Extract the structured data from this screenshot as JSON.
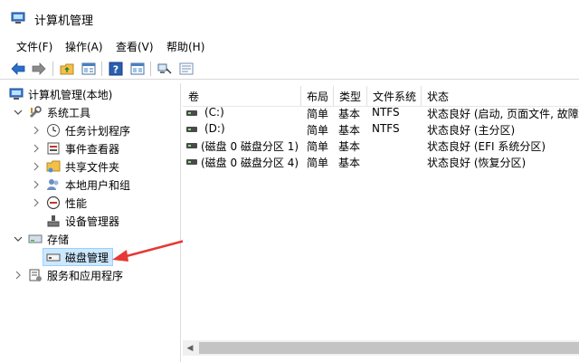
{
  "window": {
    "title": "计算机管理"
  },
  "menu": [
    {
      "label": "文件(F)"
    },
    {
      "label": "操作(A)"
    },
    {
      "label": "查看(V)"
    },
    {
      "label": "帮助(H)"
    }
  ],
  "toolbar": {
    "icons": [
      "back-arrow-icon",
      "forward-arrow-icon",
      "folder-up-icon",
      "show-hide-tree-icon",
      "help-icon",
      "properties-icon",
      "connect-icon",
      "list-view-icon"
    ]
  },
  "tree": {
    "root": "计算机管理(本地)",
    "system_tools": "系统工具",
    "task_scheduler": "任务计划程序",
    "event_viewer": "事件查看器",
    "shared_folders": "共享文件夹",
    "local_users": "本地用户和组",
    "performance": "性能",
    "device_manager": "设备管理器",
    "storage": "存储",
    "disk_management": "磁盘管理",
    "services": "服务和应用程序"
  },
  "columns": [
    {
      "label": "卷"
    },
    {
      "label": "布局"
    },
    {
      "label": "类型"
    },
    {
      "label": "文件系统"
    },
    {
      "label": "状态"
    }
  ],
  "volumes": [
    {
      "name": "(C:)",
      "layout": "简单",
      "type": "基本",
      "fs": "NTFS",
      "status": "状态良好 (启动, 页面文件, 故障转"
    },
    {
      "name": "(D:)",
      "layout": "简单",
      "type": "基本",
      "fs": "NTFS",
      "status": "状态良好 (主分区)"
    },
    {
      "name": "(磁盘 0 磁盘分区 1)",
      "layout": "简单",
      "type": "基本",
      "fs": "",
      "status": "状态良好 (EFI 系统分区)"
    },
    {
      "name": "(磁盘 0 磁盘分区 4)",
      "layout": "简单",
      "type": "基本",
      "fs": "",
      "status": "状态良好 (恢复分区)"
    }
  ],
  "colors": {
    "selection": "#cce8ff",
    "annotation_arrow": "#e53935",
    "toolbar_blue": "#2a6fc9"
  }
}
